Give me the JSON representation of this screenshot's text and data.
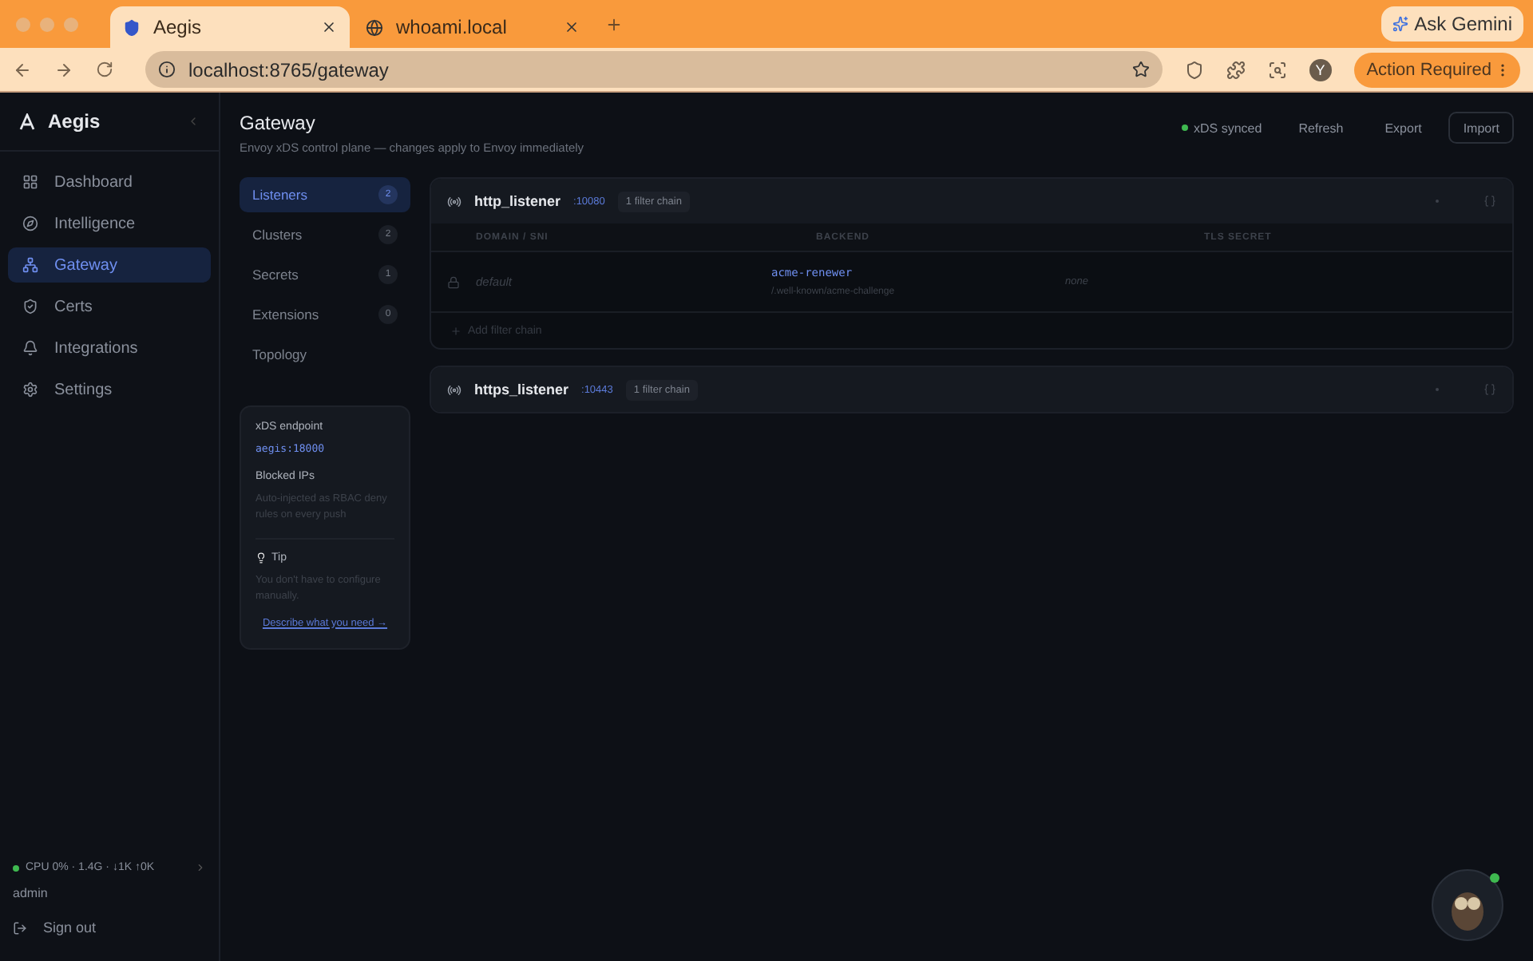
{
  "browser": {
    "tabs": [
      {
        "title": "Aegis",
        "selected": true
      },
      {
        "title": "whoami.local",
        "selected": false
      }
    ],
    "ask_button": "Ask Gemini",
    "url": "localhost:8765/gateway",
    "profile_initial": "Y",
    "action_button": "Action Required"
  },
  "sidebar": {
    "brand": "Aegis",
    "items": [
      {
        "label": "Dashboard",
        "selected": false
      },
      {
        "label": "Intelligence",
        "selected": false
      },
      {
        "label": "Gateway",
        "selected": true
      },
      {
        "label": "Certs",
        "selected": false
      },
      {
        "label": "Integrations",
        "selected": false
      },
      {
        "label": "Settings",
        "selected": false
      }
    ],
    "status": "CPU 0% · 1.4G · ↓1K ↑0K",
    "user": "admin",
    "sign_out": "Sign out"
  },
  "page": {
    "title": "Gateway",
    "subtitle": "Envoy xDS control plane — changes apply to Envoy immediately",
    "sync_status": "xDS synced",
    "actions": [
      "Refresh",
      "Export",
      "Import"
    ]
  },
  "subnav": [
    {
      "label": "Listeners",
      "count": "2",
      "selected": true
    },
    {
      "label": "Clusters",
      "count": "2",
      "selected": false
    },
    {
      "label": "Secrets",
      "count": "1",
      "selected": false
    },
    {
      "label": "Extensions",
      "count": "0",
      "selected": false
    },
    {
      "label": "Topology",
      "selected": false
    }
  ],
  "info_card": {
    "endpoint_label": "xDS endpoint",
    "endpoint": "aegis:18000",
    "blocked_label": "Blocked IPs",
    "blocked_text": "Auto-injected as RBAC deny rules on every push",
    "tip_label": "Tip",
    "tip_text": "You don't have to configure manually.",
    "tip_link": "Describe what you need →"
  },
  "listeners": [
    {
      "name": "http_listener",
      "port": ":10080",
      "chains": "1 filter chain",
      "columns": [
        "DOMAIN / SNI",
        "BACKEND",
        "TLS SECRET"
      ],
      "rows": [
        {
          "domain": "default",
          "backend": "acme-renewer",
          "path": "/.well-known/acme-challenge",
          "secret": "none"
        }
      ],
      "add_label": "Add filter chain"
    },
    {
      "name": "https_listener",
      "port": ":10443",
      "chains": "1 filter chain"
    }
  ]
}
